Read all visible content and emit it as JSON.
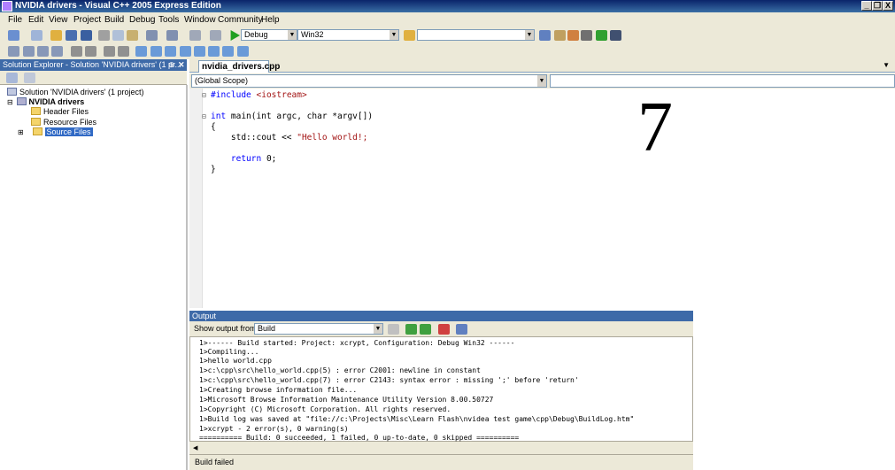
{
  "window": {
    "title": "NVIDIA drivers - Visual C++ 2005 Express Edition",
    "minimize": "_",
    "restore": "❐",
    "close": "X"
  },
  "menu": [
    "File",
    "Edit",
    "View",
    "Project",
    "Build",
    "Debug",
    "Tools",
    "Window",
    "Community",
    "Help"
  ],
  "toolbar": {
    "config": "Debug",
    "platform": "Win32",
    "find": ""
  },
  "solution_explorer": {
    "title": "Solution Explorer - Solution 'NVIDIA drivers' (1 pr...",
    "solution": "Solution 'NVIDIA drivers' (1 project)",
    "project": "NVIDIA drivers",
    "folders": [
      "Header Files",
      "Resource Files",
      "Source Files"
    ]
  },
  "editor": {
    "tab": "nvidia_drivers.cpp",
    "scope": "(Global Scope)",
    "member": "",
    "code": [
      {
        "pre": "#include ",
        "kw": "",
        "str": "<iostream>",
        "post": "",
        "kwfirst": "#include"
      },
      {
        "pre": "",
        "kw": "int",
        "str": "",
        "post": " main(int argc, char *argv[])"
      },
      {
        "pre": "{",
        "kw": "",
        "str": "",
        "post": ""
      },
      {
        "pre": "    std::cout << ",
        "kw": "",
        "str": "\"Hello world!;",
        "post": ""
      },
      {
        "pre": "    ",
        "kw": "return",
        "str": "",
        "post": " 0;"
      },
      {
        "pre": "}",
        "kw": "",
        "str": "",
        "post": ""
      }
    ],
    "overlay_number": "7"
  },
  "output": {
    "title": "Output",
    "show_from_label": "Show output from:",
    "show_from_value": "Build",
    "lines": [
      "1>------ Build started: Project: xcrypt, Configuration: Debug Win32 ------",
      "1>Compiling...",
      "1>hello world.cpp",
      "1>c:\\cpp\\src\\hello_world.cpp(5) : error C2001: newline in constant",
      "1>c:\\cpp\\src\\hello_world.cpp(7) : error C2143: syntax error : missing ';' before 'return'",
      "1>Creating browse information file...",
      "1>Microsoft Browse Information Maintenance Utility Version 8.00.50727",
      "1>Copyright (C) Microsoft Corporation. All rights reserved.",
      "1>Build log was saved at \"file://c:\\Projects\\Misc\\Learn Flash\\nvidea test game\\cpp\\Debug\\BuildLog.htm\"",
      "1>xcrypt - 2 error(s), 0 warning(s)",
      "========== Build: 0 succeeded, 1 failed, 0 up-to-date, 0 skipped =========="
    ]
  },
  "status": "Build failed",
  "colors": {
    "title_bar": "#0a246a",
    "tool_header": "#3e6aa8",
    "keyword": "#0000ff",
    "string": "#a31515",
    "chrome": "#ece9d8"
  }
}
